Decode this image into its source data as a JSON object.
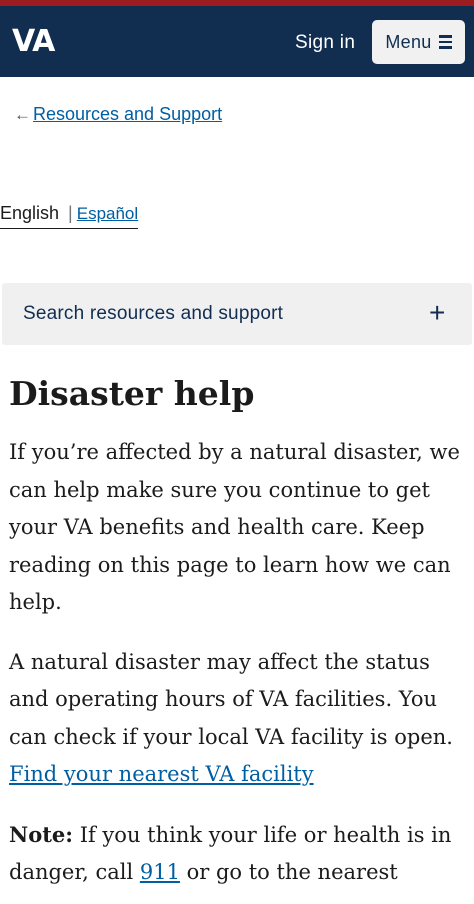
{
  "header": {
    "logo_text": "VA",
    "sign_in_label": "Sign in",
    "menu_label": "Menu",
    "stripe_color": "#9c1c20",
    "bg_color": "#112e51"
  },
  "breadcrumb": {
    "back_label": "Resources and Support",
    "icon": "arrow-left-icon"
  },
  "language": {
    "current": "English",
    "separator": "|",
    "other": "Español"
  },
  "search_accordion": {
    "label": "Search resources and support",
    "icon": "plus-icon"
  },
  "main": {
    "title": "Disaster help",
    "para1": "If you’re affected by a natural disaster, we can help make sure you continue to get your VA benefits and health care. Keep reading on this page to learn how we can help.",
    "para2_text": "A natural disaster may affect the status and operating hours of VA facilities. You can check if your local VA facility is open.",
    "para2_link": "Find your nearest VA facility",
    "note_label": "Note:",
    "note_text_1": " If you think your life or health is in danger, call ",
    "note_link": "911",
    "note_text_2": " or go to the nearest"
  }
}
